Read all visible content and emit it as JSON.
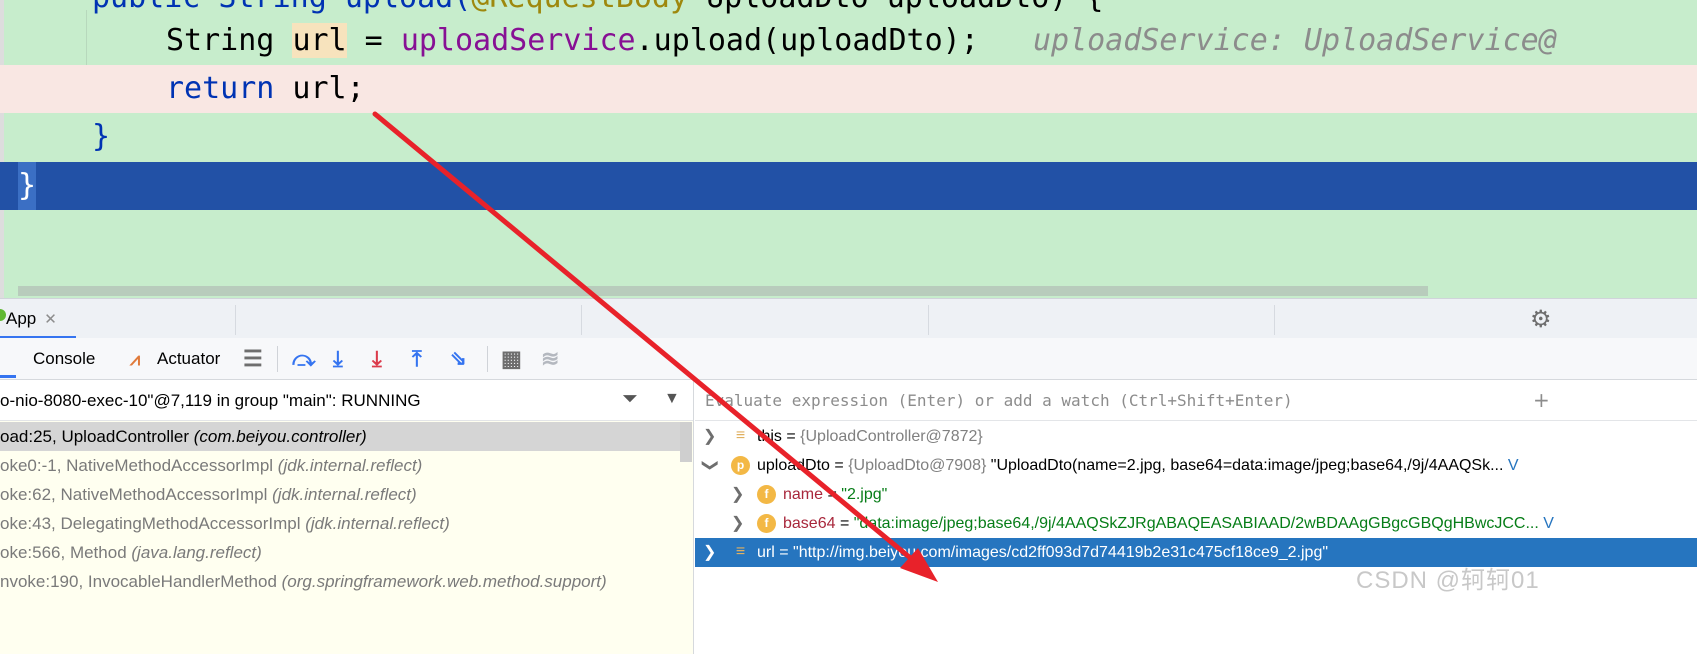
{
  "editor": {
    "line_signature": {
      "prefix": "public String upload(",
      "annotation": "@RequestBody",
      "suffix": " UploadDto uploadDto) {"
    },
    "line_assign": {
      "type": "String",
      "var": "url",
      "eq": " = ",
      "service": "uploadService",
      "call": ".upload(uploadDto);",
      "hint": "uploadService: UploadService@"
    },
    "line_return": {
      "keyword": "return",
      "rest": " url;"
    },
    "line_close_method": "}",
    "line_close_class": "}"
  },
  "run_tabs": {
    "app_label": "App",
    "close_glyph": "✕",
    "settings_icon": "gear-icon"
  },
  "debug_toolbar": {
    "console_label": "Console",
    "actuator_label": "Actuator",
    "icons": [
      "actuator-icon",
      "menu-icon",
      "step-over-icon",
      "step-into-icon",
      "force-step-into-icon",
      "step-out-icon",
      "run-to-cursor-icon",
      "evaluate-icon",
      "trace-icon"
    ]
  },
  "frames": {
    "thread": "o-nio-8080-exec-10\"@7,119 in group \"main\": RUNNING",
    "items": [
      {
        "method": "oad:25, UploadController",
        "pkg": "(com.beiyou.controller)"
      },
      {
        "method": "oke0:-1, NativeMethodAccessorImpl",
        "pkg": "(jdk.internal.reflect)"
      },
      {
        "method": "oke:62, NativeMethodAccessorImpl",
        "pkg": "(jdk.internal.reflect)"
      },
      {
        "method": "oke:43, DelegatingMethodAccessorImpl",
        "pkg": "(jdk.internal.reflect)"
      },
      {
        "method": "oke:566, Method",
        "pkg": "(java.lang.reflect)"
      },
      {
        "method": "nvoke:190, InvocableHandlerMethod",
        "pkg": "(org.springframework.web.method.support)"
      }
    ]
  },
  "variables": {
    "eval_placeholder": "Evaluate expression (Enter) or add a watch (Ctrl+Shift+Enter)",
    "add_watch_glyph": "+",
    "rows": [
      {
        "icon": "",
        "name": "this",
        "eq": " = ",
        "value": "{UploadController@7872}",
        "extra": ""
      },
      {
        "icon": "p",
        "name": "uploadDto",
        "eq": " = ",
        "value": "{UploadDto@7908}",
        "extra": " \"UploadDto(name=2.jpg, base64=data:image/jpeg;base64,/9j/4AAQSk...",
        "link": "V"
      },
      {
        "icon": "f",
        "name": "name",
        "eq": " = ",
        "value": "\"2.jpg\"",
        "extra": ""
      },
      {
        "icon": "f",
        "name": "base64",
        "eq": " = ",
        "value": "\"data:image/jpeg;base64,/9j/4AAQSkZJRgABAQEASABIAAD/2wBDAAgGBgcGBQgHBwcJCC...",
        "extra": "",
        "link": "V"
      },
      {
        "icon": "",
        "name": "url",
        "eq": " = ",
        "value": "\"http://img.beiyou.com/images/cd2ff093d7d74419b2e31c475cf18ce9_2.jpg\"",
        "extra": ""
      }
    ]
  },
  "watermark": "CSDN @轲轲01",
  "colors": {
    "editor_bg": "#c7edcc",
    "selection": "#2251a6",
    "arrow": "#e8222a",
    "accent": "#3574f0"
  }
}
